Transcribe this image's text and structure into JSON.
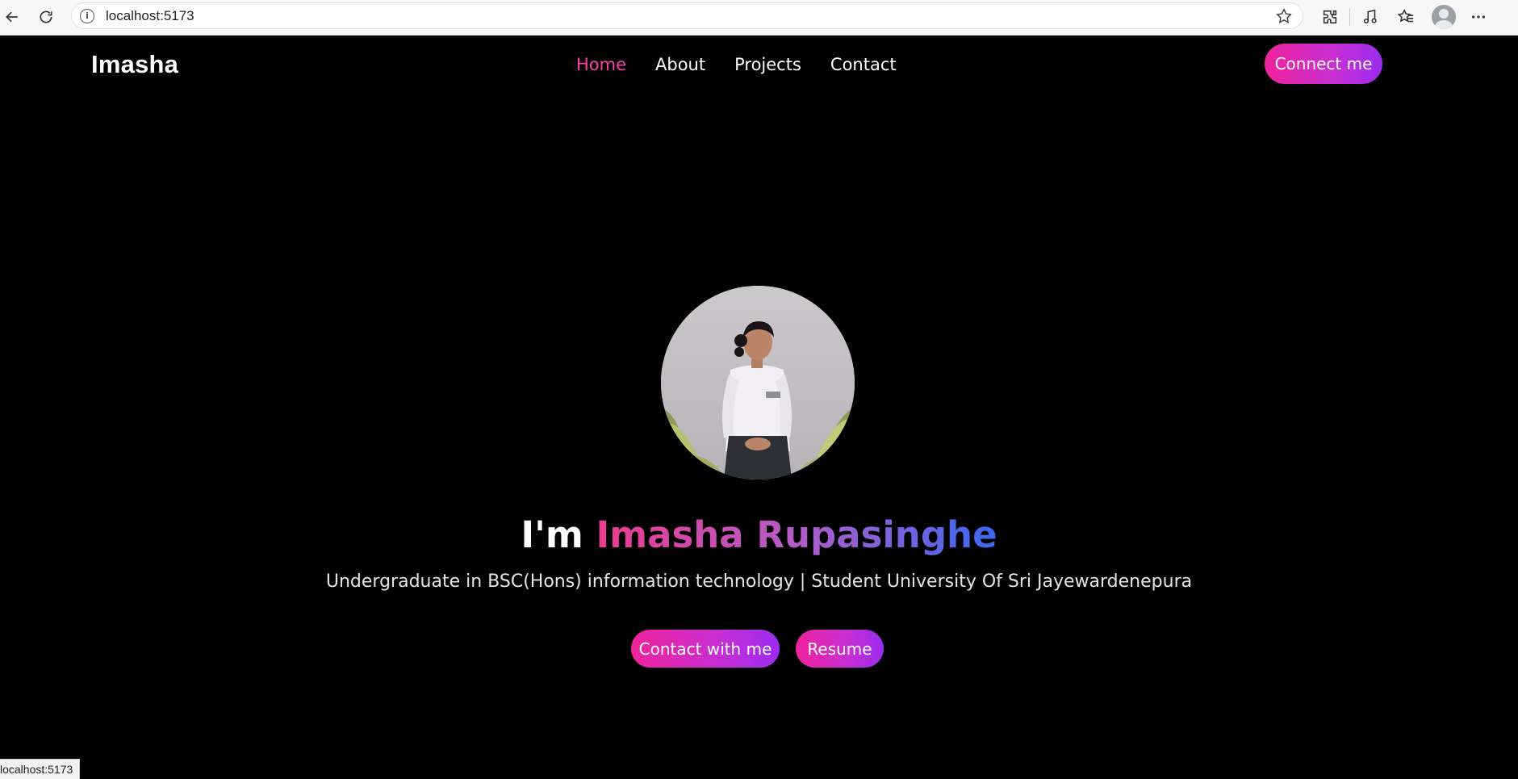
{
  "browser": {
    "url": "localhost:5173",
    "status_url": "localhost:5173"
  },
  "site": {
    "brand": "Imasha",
    "nav": [
      {
        "label": "Home",
        "active": true
      },
      {
        "label": "About",
        "active": false
      },
      {
        "label": "Projects",
        "active": false
      },
      {
        "label": "Contact",
        "active": false
      }
    ],
    "connect_label": "Connect me"
  },
  "hero": {
    "greeting": "I'm",
    "name": "Imasha Rupasinghe",
    "subtitle": "Undergraduate in BSC(Hons) information technology | Student University Of Sri Jayewardenepura",
    "contact_label": "Contact with me",
    "resume_label": "Resume"
  },
  "colors": {
    "accent_pink": "#f0239c",
    "accent_purple": "#9b2cf0",
    "active_nav": "#ff3fa6",
    "name_gradient_end": "#3a68f0"
  },
  "icons": [
    "back-arrow-icon",
    "reload-icon",
    "info-icon",
    "star-icon",
    "extensions-icon",
    "media-icon",
    "favorites-icon",
    "profile-icon",
    "more-icon"
  ]
}
